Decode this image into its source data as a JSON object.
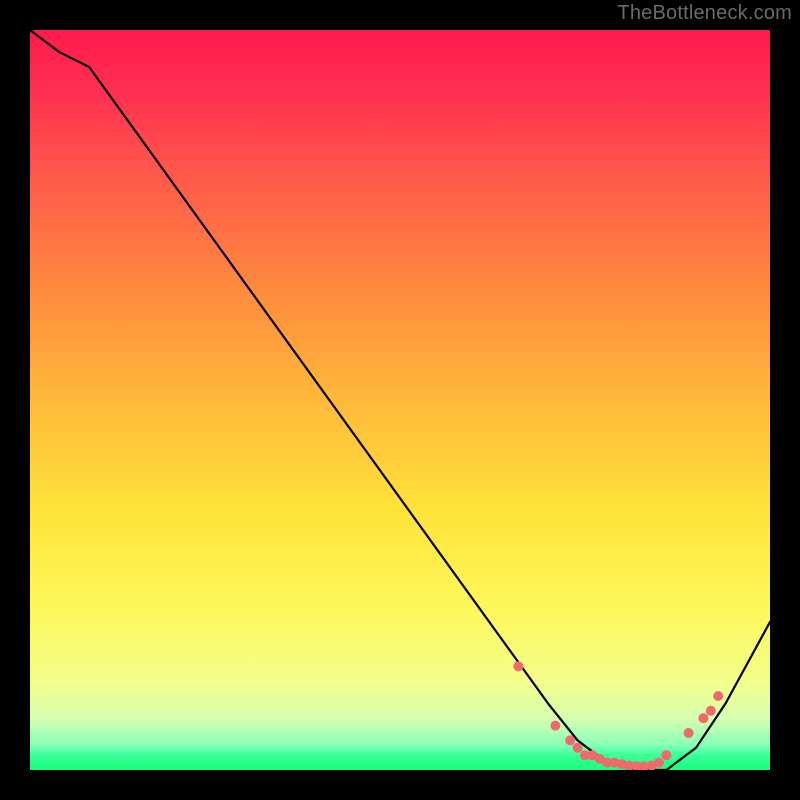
{
  "attribution": "TheBottleneck.com",
  "chart_data": {
    "type": "line",
    "title": "",
    "xlabel": "",
    "ylabel": "",
    "xlim": [
      0,
      100
    ],
    "ylim": [
      0,
      100
    ],
    "series": [
      {
        "name": "bottleneck-curve",
        "x": [
          0,
          4,
          8,
          70,
          74,
          78,
          82,
          86,
          90,
          94,
          100
        ],
        "y": [
          100,
          97,
          95,
          9,
          4,
          1,
          0,
          0,
          3,
          9,
          20
        ]
      }
    ],
    "markers": {
      "name": "highlight-points",
      "color": "#f06a6a",
      "x": [
        66,
        71,
        73,
        74,
        75,
        76,
        77,
        78,
        79,
        80,
        81,
        82,
        83,
        84,
        85,
        86,
        89,
        91,
        92,
        93
      ],
      "y": [
        14,
        6,
        4,
        3,
        2,
        2,
        1.5,
        1,
        1,
        0.8,
        0.6,
        0.5,
        0.5,
        0.6,
        1,
        2,
        5,
        7,
        8,
        10
      ]
    },
    "background": {
      "type": "vertical-gradient",
      "stops": [
        {
          "pos": 0.0,
          "color": "#ff1a4b"
        },
        {
          "pos": 0.5,
          "color": "#ffe33a"
        },
        {
          "pos": 0.93,
          "color": "#d6ffb0"
        },
        {
          "pos": 1.0,
          "color": "#16ff7a"
        }
      ]
    }
  }
}
